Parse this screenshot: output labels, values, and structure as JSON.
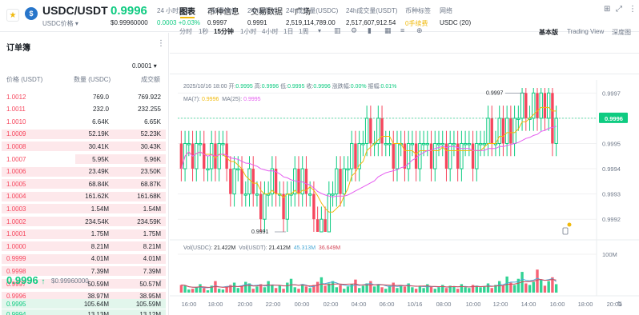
{
  "header": {
    "star_icon": "star-icon",
    "coin_symbol": "$",
    "pair": "USDC/USDT",
    "pair_sub": "USDC价格 ▾",
    "last_price": "0.9996",
    "last_price_fiat": "$0.99960000",
    "stats": [
      {
        "label": "24 小时涨跌",
        "value": "0.0003 +0.03%",
        "tone": "up"
      },
      {
        "label": "24h最高价",
        "value": "0.9997",
        "tone": ""
      },
      {
        "label": "24h最低价",
        "value": "0.9991",
        "tone": ""
      },
      {
        "label": "24h成交量(USDC)",
        "value": "2,519,114,789.00",
        "tone": ""
      },
      {
        "label": "24h成交量(USDT)",
        "value": "2,517,607,912.54",
        "tone": ""
      },
      {
        "label": "币种标签",
        "value": "0手续费",
        "tone": "orange"
      },
      {
        "label": "网络",
        "value": "USDC (20)",
        "tone": ""
      }
    ]
  },
  "orderbook": {
    "title": "订单簿",
    "menu": "⋮",
    "precision": "0.0001 ▾",
    "headers": [
      "价格 (USDT)",
      "数量 (USDC)",
      "成交额"
    ],
    "asks": [
      {
        "p": "1.0012",
        "a": "769.0",
        "t": "769.922",
        "d": 0
      },
      {
        "p": "1.0011",
        "a": "232.0",
        "t": "232.255",
        "d": 0
      },
      {
        "p": "1.0010",
        "a": "6.64K",
        "t": "6.65K",
        "d": 0
      },
      {
        "p": "1.0009",
        "a": "52.19K",
        "t": "52.23K",
        "d": 1
      },
      {
        "p": "1.0008",
        "a": "30.41K",
        "t": "30.43K",
        "d": 1
      },
      {
        "p": "1.0007",
        "a": "5.95K",
        "t": "5.96K",
        "d": 0.55
      },
      {
        "p": "1.0006",
        "a": "23.49K",
        "t": "23.50K",
        "d": 1
      },
      {
        "p": "1.0005",
        "a": "68.84K",
        "t": "68.87K",
        "d": 1
      },
      {
        "p": "1.0004",
        "a": "161.62K",
        "t": "161.68K",
        "d": 1
      },
      {
        "p": "1.0003",
        "a": "1.54M",
        "t": "1.54M",
        "d": 1
      },
      {
        "p": "1.0002",
        "a": "234.54K",
        "t": "234.59K",
        "d": 1
      },
      {
        "p": "1.0001",
        "a": "1.75M",
        "t": "1.75M",
        "d": 1
      },
      {
        "p": "1.0000",
        "a": "8.21M",
        "t": "8.21M",
        "d": 1
      },
      {
        "p": "0.9999",
        "a": "4.01M",
        "t": "4.01M",
        "d": 1
      },
      {
        "p": "0.9998",
        "a": "7.39M",
        "t": "7.39M",
        "d": 1
      },
      {
        "p": "0.9997",
        "a": "50.59M",
        "t": "50.57M",
        "d": 1
      },
      {
        "p": "0.9996",
        "a": "38.97M",
        "t": "38.95M",
        "d": 1
      }
    ],
    "mid_price": "0.9996",
    "mid_arrow": "↑",
    "mid_fiat": "$0.99960000",
    "mid_more": "›",
    "bids": [
      {
        "p": "0.9995",
        "a": "105.64M",
        "t": "105.59M",
        "d": 1
      },
      {
        "p": "0.9994",
        "a": "13.13M",
        "t": "13.12M",
        "d": 1
      }
    ]
  },
  "chart_tabs": [
    {
      "label": "图表",
      "active": true
    },
    {
      "label": "币种信息",
      "active": false
    },
    {
      "label": "交易数据",
      "active": false
    },
    {
      "label": "广场",
      "active": false
    }
  ],
  "toolbar_icons": [
    "grid-icon",
    "expand-icon",
    "more-icon"
  ],
  "intervals": [
    {
      "label": "分时",
      "active": false
    },
    {
      "label": "1秒",
      "active": false
    },
    {
      "label": "15分钟",
      "active": true
    },
    {
      "label": "1小时",
      "active": false
    },
    {
      "label": "4小时",
      "active": false
    },
    {
      "label": "1日",
      "active": false
    },
    {
      "label": "1周",
      "active": false
    },
    {
      "label": "▾",
      "active": false
    }
  ],
  "chart_tools": [
    "indicator-icon",
    "settings-icon",
    "chart-type-icon",
    "layout-icon",
    "depth-icon",
    "add-icon"
  ],
  "views": [
    {
      "label": "基本版",
      "active": true
    },
    {
      "label": "Trading View",
      "active": false
    },
    {
      "label": "深度图",
      "active": false
    }
  ],
  "info": {
    "datetime": "2025/10/16 18:00",
    "open_label": "开:",
    "open": "0.9995",
    "high_label": "高:",
    "high": "0.9996",
    "low_label": "低:",
    "low": "0.9995",
    "close_label": "收:",
    "close": "0.9996",
    "chg_label": "涨跌幅:",
    "chg": "0.00%",
    "amp_label": "振幅:",
    "amp": "0.01%",
    "ma7_label": "MA(7):",
    "ma7": "0.9996",
    "ma25_label": "MA(25):",
    "ma25": "0.9995",
    "vol_usdc_label": "Vol(USDC):",
    "vol_usdc": "21.422M",
    "vol_usdt_label": "Vol(USDT):",
    "vol_usdt": "21.412M",
    "vol_ma1": "45.313M",
    "vol_ma2": "36.649M"
  },
  "colors": {
    "up": "#0ecb81",
    "down": "#f6465d",
    "ma7": "#f0b90b",
    "ma25": "#e55df0",
    "vol_ma1": "#4aa9d6",
    "vol_ma2": "#d4495b"
  },
  "chart_data": {
    "type": "candlestick",
    "interval": "15分钟",
    "y_ticks": [
      "0.9997",
      "0.9996",
      "0.9995",
      "0.9994",
      "0.9993",
      "0.9992"
    ],
    "ylim": [
      0.99915,
      0.99972
    ],
    "x_ticks": [
      "16:00",
      "18:00",
      "20:00",
      "22:00",
      "00:00",
      "02:00",
      "04:00",
      "06:00",
      "10/16",
      "08:00",
      "10:00",
      "12:00",
      "14:00",
      "16:00",
      "18:00",
      "20:00"
    ],
    "current_price": "0.9996",
    "high_marker": "0.9997",
    "low_marker": "0.9991",
    "volume_tick": "100M",
    "candles": [
      [
        0.9995,
        0.9994
      ],
      [
        0.9994,
        0.9995
      ],
      [
        0.9995,
        0.9995
      ],
      [
        0.9995,
        0.9994
      ],
      [
        0.9994,
        0.9995
      ],
      [
        0.9995,
        0.9995
      ],
      [
        0.9995,
        0.9994
      ],
      [
        0.9994,
        0.9994
      ],
      [
        0.9994,
        0.9995
      ],
      [
        0.9995,
        0.9994
      ],
      [
        0.9994,
        0.9995
      ],
      [
        0.9995,
        0.9995
      ],
      [
        0.9995,
        0.9994
      ],
      [
        0.9994,
        0.9993
      ],
      [
        0.9993,
        0.9994
      ],
      [
        0.9994,
        0.9994
      ],
      [
        0.9994,
        0.9993
      ],
      [
        0.9993,
        0.9993
      ],
      [
        0.9993,
        0.9994
      ],
      [
        0.9994,
        0.9993
      ],
      [
        0.9993,
        0.9993
      ],
      [
        0.9993,
        0.9992
      ],
      [
        0.9992,
        0.9993
      ],
      [
        0.9993,
        0.9993
      ],
      [
        0.9993,
        0.9994
      ],
      [
        0.9994,
        0.9993
      ],
      [
        0.9993,
        0.9993
      ],
      [
        0.9993,
        0.9992
      ],
      [
        0.9992,
        0.9993
      ],
      [
        0.9993,
        0.9993
      ],
      [
        0.9993,
        0.9994
      ],
      [
        0.9994,
        0.9993
      ],
      [
        0.9993,
        0.9994
      ],
      [
        0.9994,
        0.9993
      ],
      [
        0.9993,
        0.9993
      ],
      [
        0.9993,
        0.9992
      ],
      [
        0.9992,
        0.99915
      ],
      [
        0.99915,
        0.9992
      ],
      [
        0.9992,
        0.99915
      ],
      [
        0.99915,
        0.9993
      ],
      [
        0.9993,
        0.9993
      ],
      [
        0.9993,
        0.9994
      ],
      [
        0.9994,
        0.9993
      ],
      [
        0.9993,
        0.9994
      ],
      [
        0.9994,
        0.9994
      ],
      [
        0.9994,
        0.9995
      ],
      [
        0.9995,
        0.9994
      ],
      [
        0.9994,
        0.9995
      ],
      [
        0.9995,
        0.9995
      ],
      [
        0.9995,
        0.9996
      ],
      [
        0.9996,
        0.9995
      ],
      [
        0.9995,
        0.9995
      ],
      [
        0.9995,
        0.9996
      ],
      [
        0.9996,
        0.9995
      ],
      [
        0.9995,
        0.9995
      ],
      [
        0.9995,
        0.9995
      ],
      [
        0.9995,
        0.9994
      ],
      [
        0.9994,
        0.9995
      ],
      [
        0.9995,
        0.9995
      ],
      [
        0.9995,
        0.9994
      ],
      [
        0.9994,
        0.9995
      ],
      [
        0.9995,
        0.9995
      ],
      [
        0.9995,
        0.9994
      ],
      [
        0.9994,
        0.9995
      ],
      [
        0.9995,
        0.9995
      ],
      [
        0.9995,
        0.9995
      ],
      [
        0.9995,
        0.9994
      ],
      [
        0.9994,
        0.9995
      ],
      [
        0.9995,
        0.9995
      ],
      [
        0.9995,
        0.9995
      ],
      [
        0.9995,
        0.9994
      ],
      [
        0.9994,
        0.9995
      ],
      [
        0.9995,
        0.9995
      ],
      [
        0.9995,
        0.9994
      ],
      [
        0.9994,
        0.9995
      ],
      [
        0.9995,
        0.9995
      ],
      [
        0.9995,
        0.9995
      ],
      [
        0.9995,
        0.9994
      ],
      [
        0.9994,
        0.9995
      ],
      [
        0.9995,
        0.9995
      ],
      [
        0.9995,
        0.9995
      ],
      [
        0.9995,
        0.9996
      ],
      [
        0.9996,
        0.9995
      ],
      [
        0.9995,
        0.9995
      ],
      [
        0.9995,
        0.9996
      ],
      [
        0.9996,
        0.9995
      ],
      [
        0.9995,
        0.9996
      ],
      [
        0.9996,
        0.9995
      ],
      [
        0.9995,
        0.9996
      ],
      [
        0.9996,
        0.9996
      ],
      [
        0.9996,
        0.9997
      ],
      [
        0.9997,
        0.9996
      ],
      [
        0.9996,
        0.9996
      ],
      [
        0.9996,
        0.9997
      ],
      [
        0.9997,
        0.9996
      ],
      [
        0.9996,
        0.9997
      ],
      [
        0.9997,
        0.9996
      ],
      [
        0.9996,
        0.9997
      ],
      [
        0.9997,
        0.9995
      ],
      [
        0.9995,
        0.9996
      ]
    ],
    "volumes": [
      20,
      18,
      8,
      10,
      14,
      22,
      12,
      6,
      18,
      30,
      10,
      8,
      14,
      20,
      26,
      12,
      18,
      28,
      24,
      10,
      16,
      22,
      14,
      30,
      20,
      12,
      18,
      10,
      26,
      36,
      14,
      10,
      22,
      16,
      12,
      20,
      28,
      40,
      18,
      24,
      30,
      14,
      20,
      10,
      16,
      22,
      34,
      12,
      18,
      24,
      30,
      16,
      20,
      14,
      10,
      18,
      26,
      12,
      20,
      16,
      24,
      14,
      10,
      18,
      12,
      22,
      16,
      10,
      14,
      20,
      12,
      18,
      16,
      10,
      22,
      14,
      12,
      20,
      18,
      14,
      16,
      24,
      12,
      20,
      30,
      18,
      42,
      26,
      20,
      36,
      54,
      24,
      20,
      28,
      60,
      34,
      18,
      30,
      40,
      22
    ]
  }
}
